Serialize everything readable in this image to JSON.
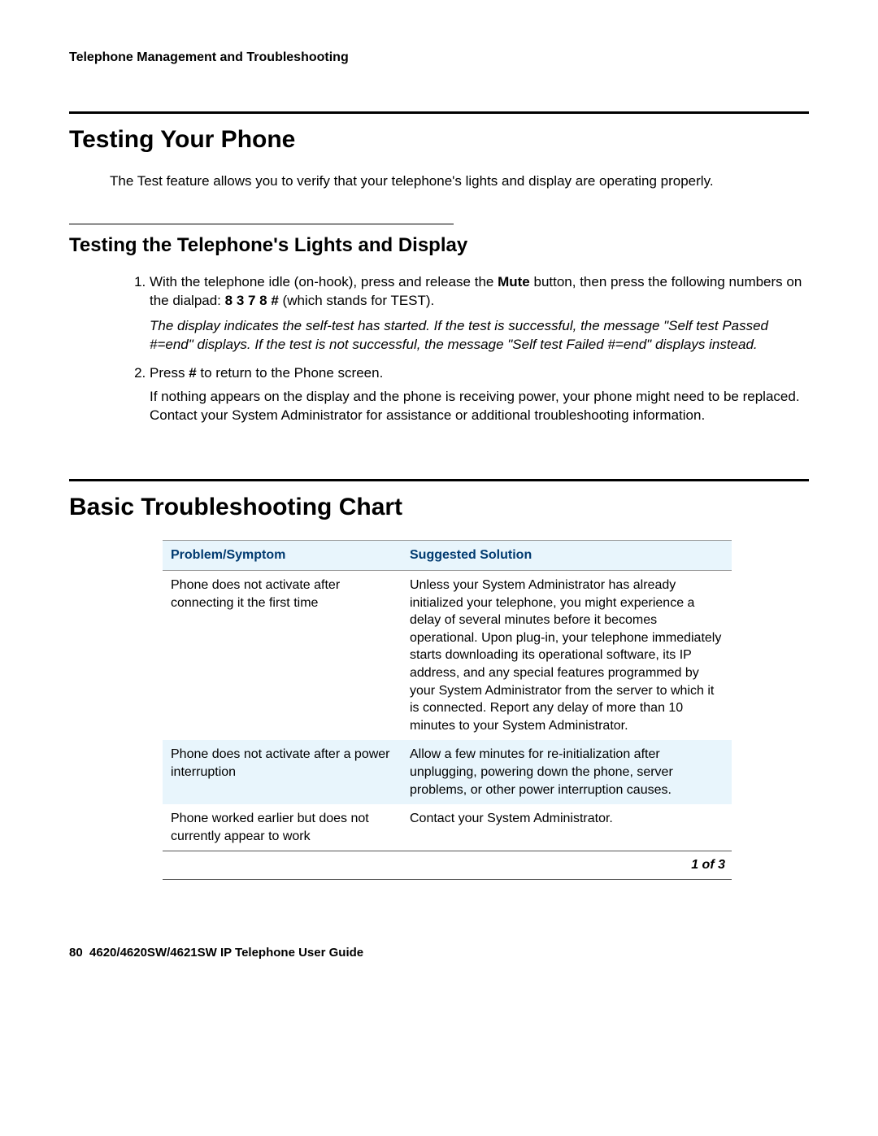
{
  "header": {
    "running": "Telephone Management and Troubleshooting"
  },
  "section1": {
    "title": "Testing Your Phone",
    "intro": "The Test feature allows you to verify that your telephone's lights and display are operating properly.",
    "sub": {
      "title": "Testing the Telephone's Lights and Display",
      "step1_a": "With the telephone idle (on-hook), press and release the ",
      "step1_mute": "Mute",
      "step1_b": " button, then press the following numbers on the dialpad: ",
      "step1_code": "8 3 7 8 #",
      "step1_c": " (which stands for TEST).",
      "result": "The display indicates the self-test has started. If the test is successful, the message \"Self test Passed #=end\" displays. If the test is not successful, the message \"Self test Failed #=end\" displays instead.",
      "step2_a": "Press ",
      "step2_hash": "#",
      "step2_b": " to return to the Phone screen.",
      "followup": "If nothing appears on the display and the phone is receiving power, your phone might need to be replaced. Contact your System Administrator for assistance or additional troubleshooting information."
    }
  },
  "section2": {
    "title": "Basic Troubleshooting Chart",
    "columns": {
      "c1": "Problem/Symptom",
      "c2": "Suggested Solution"
    },
    "rows": [
      {
        "problem": "Phone does not activate after connecting it the first time",
        "solution": "Unless your System Administrator has already initialized your telephone, you might experience a delay of several minutes before it becomes operational. Upon plug-in, your telephone immediately starts downloading its operational software, its IP address, and any special features programmed by your System Administrator from the server to which it is connected. Report any delay of more than 10 minutes to your System Administrator."
      },
      {
        "problem": "Phone does not activate after a power interruption",
        "solution": "Allow a few minutes for re-initialization after unplugging, powering down the phone, server problems, or other power interruption causes."
      },
      {
        "problem": "Phone worked earlier but does not currently appear to work",
        "solution": "Contact your System Administrator."
      }
    ],
    "pager": "1 of 3"
  },
  "footer": {
    "page": "80",
    "guide": "4620/4620SW/4621SW IP Telephone User Guide"
  }
}
